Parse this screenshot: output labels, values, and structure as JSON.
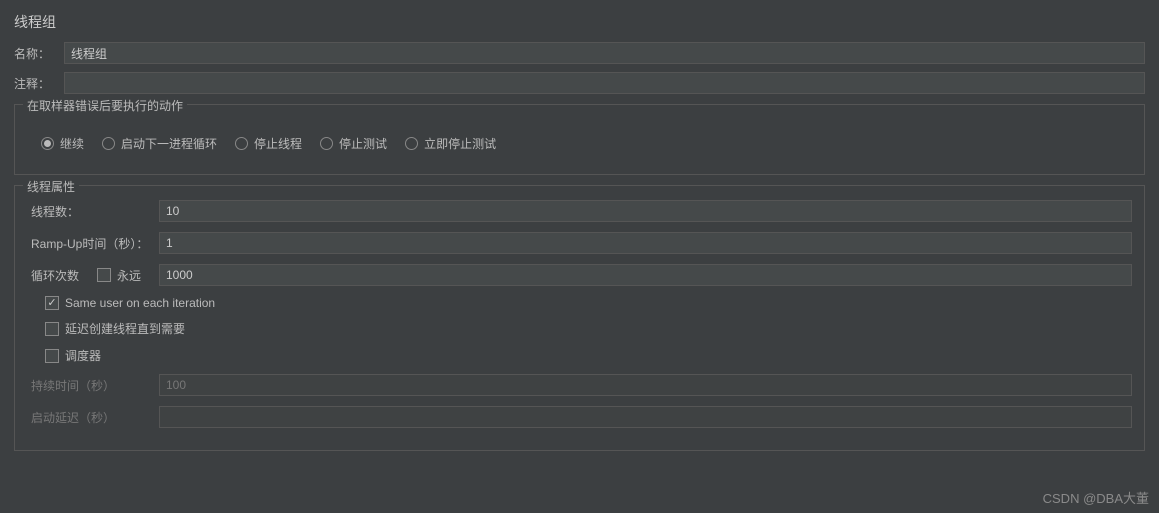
{
  "title": "线程组",
  "name": {
    "label": "名称：",
    "value": "线程组"
  },
  "comment": {
    "label": "注释：",
    "value": ""
  },
  "errorFieldset": {
    "legend": "在取样器错误后要执行的动作",
    "options": {
      "continue": "继续",
      "startNextLoop": "启动下一进程循环",
      "stopThread": "停止线程",
      "stopTest": "停止测试",
      "stopNow": "立即停止测试"
    },
    "selected": "continue"
  },
  "propsFieldset": {
    "legend": "线程属性",
    "threads": {
      "label": "线程数：",
      "value": "10"
    },
    "rampUp": {
      "label": "Ramp-Up时间（秒）：",
      "value": "1"
    },
    "loop": {
      "label": "循环次数",
      "forever": "永远",
      "foreverChecked": false,
      "value": "1000"
    },
    "sameUser": {
      "label": "Same user on each iteration",
      "checked": true
    },
    "delayStart": {
      "label": "延迟创建线程直到需要",
      "checked": false
    },
    "scheduler": {
      "label": "调度器",
      "checked": false
    },
    "duration": {
      "label": "持续时间（秒）",
      "value": "100"
    },
    "startupDelay": {
      "label": "启动延迟（秒）",
      "value": ""
    }
  },
  "watermark": "CSDN @DBA大董"
}
